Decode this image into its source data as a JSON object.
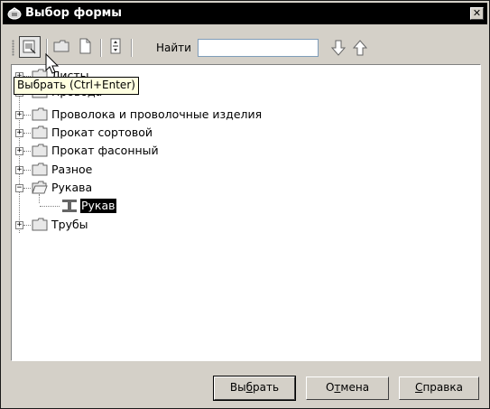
{
  "window": {
    "title": "Выбор формы",
    "close_symbol": "✕"
  },
  "toolbar": {
    "find_label": "Найти",
    "find_value": "",
    "tooltip": "Выбрать (Ctrl+Enter)"
  },
  "tree": {
    "items": [
      {
        "label": "Листы",
        "expanded": false
      },
      {
        "label": "Провода",
        "expanded": false
      },
      {
        "label": "Проволока и проволочные изделия",
        "expanded": false
      },
      {
        "label": "Прокат сортовой",
        "expanded": false
      },
      {
        "label": "Прокат фасонный",
        "expanded": false
      },
      {
        "label": "Разное",
        "expanded": false
      },
      {
        "label": "Рукава",
        "expanded": true,
        "children": [
          {
            "label": "Рукав",
            "selected": true
          }
        ]
      },
      {
        "label": "Трубы",
        "expanded": false
      }
    ]
  },
  "buttons": {
    "select_pre": "Вы",
    "select_u": "б",
    "select_post": "рать",
    "cancel_pre": "О",
    "cancel_u": "т",
    "cancel_post": "мена",
    "help_pre": "",
    "help_u": "С",
    "help_post": "правка"
  },
  "icons": {
    "title": "form-window-icon",
    "select": "select-form-icon",
    "new_folder": "folder-icon",
    "new_item": "document-icon",
    "move": "move-icon",
    "find_next": "arrow-down-icon",
    "find_prev": "arrow-up-icon"
  }
}
